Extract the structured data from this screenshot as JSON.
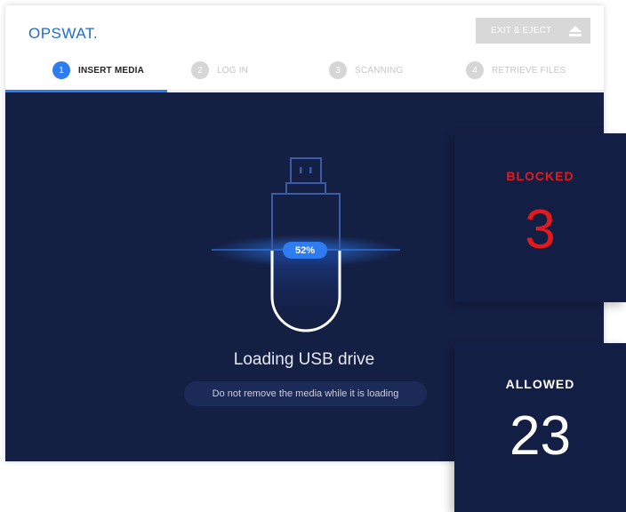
{
  "brand": {
    "logo_text": "OPSWAT."
  },
  "header": {
    "exit_button_label": "EXIT & EJECT",
    "exit_icon": "eject-icon"
  },
  "steps": [
    {
      "number": "1",
      "label": "INSERT MEDIA",
      "state": "active"
    },
    {
      "number": "2",
      "label": "LOG IN",
      "state": "inactive"
    },
    {
      "number": "3",
      "label": "SCANNING",
      "state": "inactive"
    },
    {
      "number": "4",
      "label": "RETRIEVE FILES",
      "state": "inactive"
    }
  ],
  "workflow_progress": {
    "fraction": 0.27
  },
  "loading": {
    "usb_icon": "usb-drive-icon",
    "percent_label": "52%",
    "fill_fraction": 0.52,
    "title": "Loading USB drive",
    "note": "Do not remove the media while it is loading"
  },
  "stats": {
    "blocked": {
      "label": "BLOCKED",
      "value": "3"
    },
    "allowed": {
      "label": "ALLOWED",
      "value": "23"
    }
  },
  "colors": {
    "accent": "#2f7cf1",
    "body_background": "#141f44",
    "blocked": "#e11b1b",
    "allowed": "#ffffff"
  }
}
